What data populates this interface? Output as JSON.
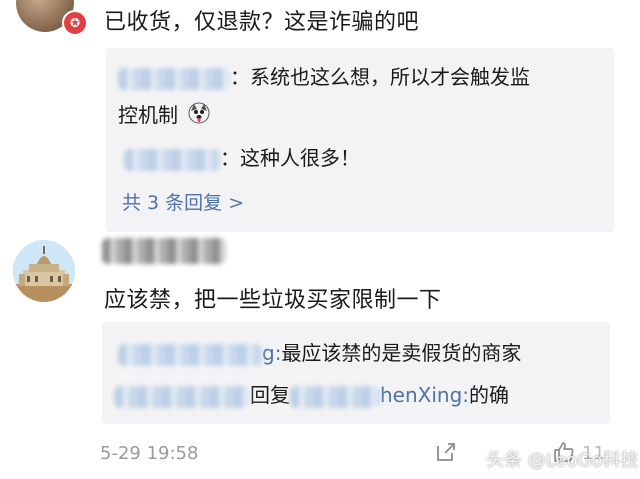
{
  "comment1": {
    "text": "已收货，仅退款？这是诈骗的吧",
    "replies": [
      {
        "name_tail": "：",
        "text": "系统也这么想，所以才会触发监"
      },
      {
        "text": "控机制"
      },
      {
        "name_tail": "：",
        "text": "这种人很多！"
      }
    ],
    "expand_label": "共 3 条回复 >"
  },
  "comment2": {
    "text": "应该禁，把一些垃圾买家限制一下",
    "replies": [
      {
        "name_tail": "g:",
        "text": "最应该禁的是卖假货的商家"
      },
      {
        "reply_word": "回复",
        "mention": "henXing:",
        "text": "的确"
      }
    ],
    "timestamp": "5-29 19:58"
  },
  "icons": {
    "badge": "vip-badge-icon",
    "emoji": "husky-emoji-icon",
    "share": "share-icon",
    "like": "thumbs-up-icon"
  },
  "like_count": "11",
  "watermark": "头条 @LeoGo科技"
}
